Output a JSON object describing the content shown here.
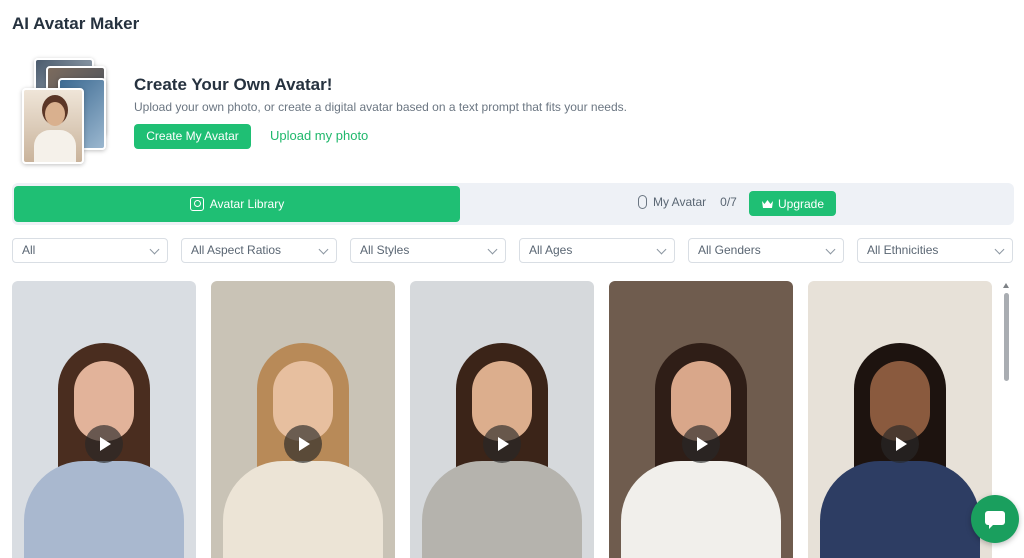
{
  "app": {
    "title": "AI Avatar Maker"
  },
  "hero": {
    "title": "Create Your Own Avatar!",
    "description": "Upload your own photo, or create a digital avatar based on a text prompt that fits your needs.",
    "create_label": "Create My Avatar",
    "upload_label": "Upload my photo"
  },
  "tabs": {
    "library_label": "Avatar Library",
    "my_avatar_label": "My Avatar",
    "my_avatar_count": "0/7",
    "upgrade_label": "Upgrade"
  },
  "filters": [
    {
      "label": "All"
    },
    {
      "label": "All Aspect Ratios"
    },
    {
      "label": "All Styles"
    },
    {
      "label": "All Ages"
    },
    {
      "label": "All Genders"
    },
    {
      "label": "All Ethnicities"
    }
  ],
  "avatars": [
    {
      "bg": "#d9dde2",
      "hair": "#4a2d1f",
      "skin": "#e2b39a",
      "top": "#a9b8cf"
    },
    {
      "bg": "#c9c3b6",
      "hair": "#b88a58",
      "skin": "#e7bf9f",
      "top": "#ece4d6"
    },
    {
      "bg": "#d6d9dc",
      "hair": "#3b2418",
      "skin": "#dcae8d",
      "top": "#b5b3ad"
    },
    {
      "bg": "#6f5c4e",
      "hair": "#2f1e17",
      "skin": "#d9a78a",
      "top": "#f1efeb"
    },
    {
      "bg": "#e7e1d8",
      "hair": "#1d130f",
      "skin": "#8a5a3e",
      "top": "#2d3d63"
    }
  ],
  "colors": {
    "accent": "#1fbf74",
    "chat": "#1a9f5e"
  },
  "icons": [
    "avatar-library-icon",
    "my-avatar-icon",
    "crown-icon",
    "chevron-down-icon",
    "play-icon",
    "chat-icon"
  ]
}
